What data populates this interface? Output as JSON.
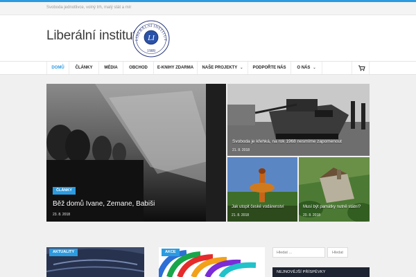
{
  "topbar": {
    "tagline": "Svoboda jednotlivce, volný trh, malý stát a mír"
  },
  "header": {
    "site_title": "Liberální institut",
    "logo_ring_text": "LIBERÁLNÍ INSTITUT",
    "logo_monogram": "LI",
    "logo_year": "1989"
  },
  "nav": {
    "items": [
      {
        "label": "DOMŮ"
      },
      {
        "label": "ČLÁNKY"
      },
      {
        "label": "MÉDIA"
      },
      {
        "label": "OBCHOD"
      },
      {
        "label": "E-KNIHY ZDARMA"
      },
      {
        "label": "NAŠE PROJEKTY"
      },
      {
        "label": "PODPOŘTE NÁS"
      },
      {
        "label": "O NÁS"
      }
    ],
    "cart_icon": "cart-icon"
  },
  "featured": {
    "main": {
      "badge": "ČLÁNKY",
      "title": "Běž domů Ivane, Zemane, Babiši",
      "date": "23. 8. 2018"
    },
    "top_right": {
      "title": "Svoboda je křehká, na rok 1968 nesmíme zapomenout",
      "date": "21. 8. 2018"
    },
    "bottom_left": {
      "title": "Jak utopit české vodárenství",
      "date": "21. 8. 2018"
    },
    "bottom_right": {
      "title": "Musí být památky nutně státní?",
      "date": "20. 8. 2018"
    }
  },
  "cards": [
    {
      "badge": "AKTUALITY"
    },
    {
      "badge": "AKCE"
    }
  ],
  "sidebar": {
    "search_placeholder": "Hledat ...",
    "search_button": "Hledat",
    "recent_title": "NEJNOVĚJŠÍ PŘÍSPĚVKY"
  },
  "colors": {
    "accent": "#2c9be0",
    "dark": "#1d2330"
  }
}
